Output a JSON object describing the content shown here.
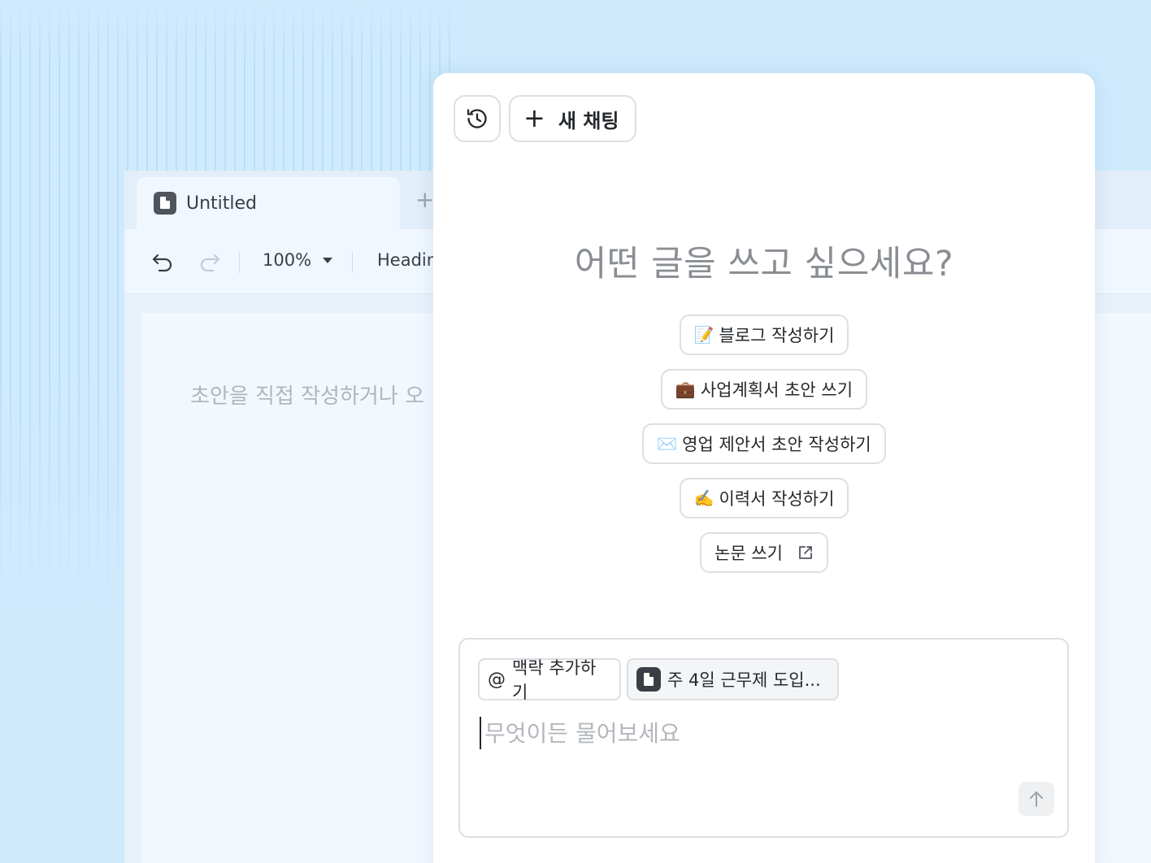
{
  "editor": {
    "tab": {
      "title": "Untitled",
      "add_label": "+"
    },
    "toolbar": {
      "zoom": "100%",
      "style": "Headin"
    },
    "placeholder": "초안을 직접 작성하거나 오"
  },
  "chat": {
    "new_chat_label": "새 채팅",
    "headline": "어떤 글을 쓰고 싶으세요?",
    "suggestions": [
      {
        "emoji": "📝",
        "label": "블로그 작성하기"
      },
      {
        "emoji": "💼",
        "label": "사업계획서 초안 쓰기"
      },
      {
        "emoji": "✉️",
        "label": "영업 제안서 초안 작성하기"
      },
      {
        "emoji": "✍️",
        "label": "이력서 작성하기"
      },
      {
        "emoji": "",
        "label": "논문 쓰기",
        "icon": "external-link-icon"
      }
    ],
    "composer": {
      "context_add": {
        "symbol": "@",
        "label": "맥락 추가하기"
      },
      "context_doc": "주 4일 근무제 도입...",
      "placeholder": "무엇이든 물어보세요"
    }
  },
  "colors": {
    "background": "#cfeafd",
    "panel": "#ffffff",
    "border": "#dcdfe3",
    "muted_text": "#8a8e93"
  }
}
